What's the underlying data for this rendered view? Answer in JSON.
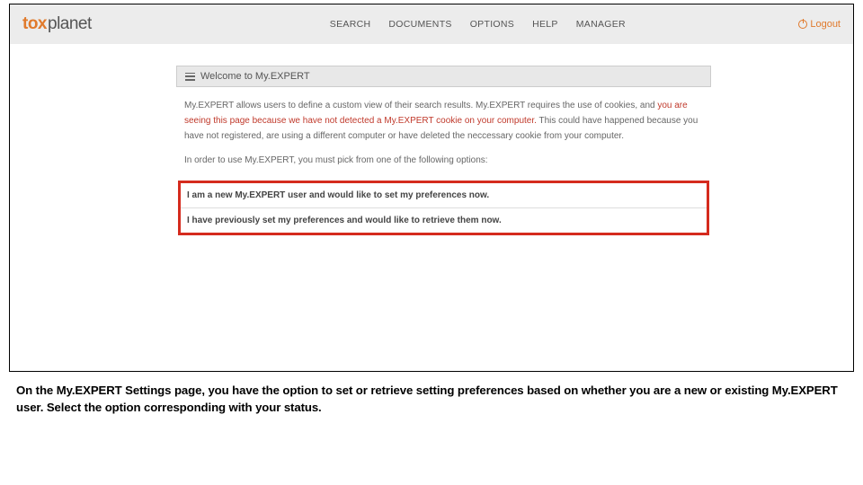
{
  "logo": {
    "part1": "tox",
    "part2": "planet"
  },
  "nav": {
    "search": "SEARCH",
    "documents": "DOCUMENTS",
    "options": "OPTIONS",
    "help": "HELP",
    "manager": "MANAGER"
  },
  "logout_label": "Logout",
  "panel": {
    "title": "Welcome to My.EXPERT",
    "para1_a": "My.EXPERT allows users to define a custom view of their search results. My.EXPERT requires the use of cookies, and ",
    "para1_b": "you are seeing this page because we have not detected a My.EXPERT cookie on your computer.",
    "para1_c": " This could have happened because you have not registered, are using a different computer or have deleted the neccessary cookie from your computer.",
    "para2": "In order to use My.EXPERT, you must pick from one of the following options:",
    "option1": "I am a new My.EXPERT user and would like to set my preferences now.",
    "option2": "I have previously set my preferences and would like to retrieve them now."
  },
  "caption": "On the My.EXPERT Settings page, you have the option to set or retrieve setting preferences based on whether you are a new or existing My.EXPERT user.  Select the option corresponding with your status."
}
